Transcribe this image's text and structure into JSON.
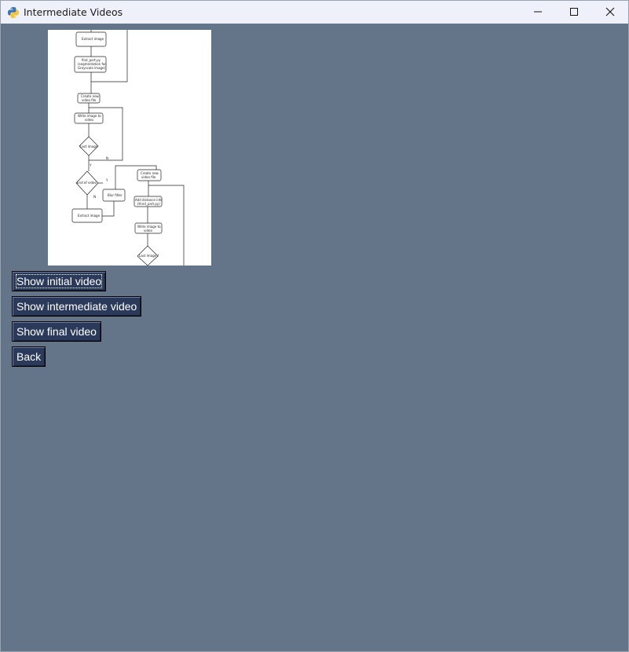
{
  "window": {
    "title": "Intermediate Videos",
    "background": "#64758a",
    "titlebar_background": "#eef1f9"
  },
  "icons": {
    "app": "python-logo-icon",
    "minimize": "minimize-icon",
    "maximize": "maximize-icon",
    "close": "close-icon"
  },
  "flowchart": {
    "extract_image_top": "Extract image",
    "find_part_line1": "find_part.py",
    "find_part_line2": "(segmentation for",
    "find_part_line3": "Greyscale image)",
    "create_video_line1": "Create new",
    "create_video_line2": "video file",
    "write_image_line1": "Write image to",
    "write_image_line2": "video",
    "last_image": "Last image",
    "end_of_video": "End of video",
    "blur_filter": "Blur filter",
    "extract_image_bottom": "Extract image",
    "create_video2_line1": "Create new",
    "create_video2_line2": "video file",
    "add_distance_line1": "Add distance info",
    "add_distance_line2": "(third_part.py)",
    "write_image2_line1": "Write image to",
    "write_image2_line2": "video",
    "last_image2": "Last image ?",
    "label_y1": "Y",
    "label_n1": "N",
    "label_y2": "Y",
    "label_n2": "N"
  },
  "buttons": {
    "show_initial": "Show initial video",
    "show_intermediate": "Show intermediate video",
    "show_final": "Show final video",
    "back": "Back"
  },
  "colors": {
    "button_bg": "#2b3a5b",
    "button_text": "#ffffff"
  }
}
